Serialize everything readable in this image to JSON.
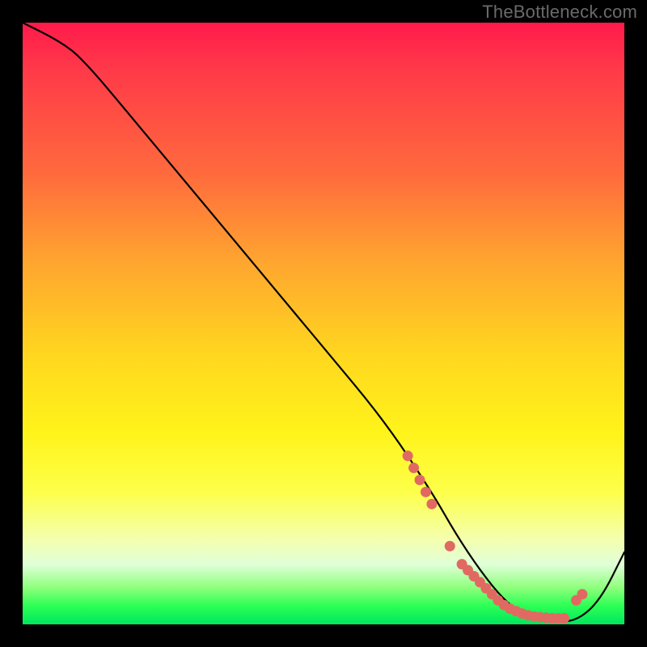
{
  "watermark": "TheBottleneck.com",
  "chart_data": {
    "type": "line",
    "title": "",
    "xlabel": "",
    "ylabel": "",
    "xlim": [
      0,
      100
    ],
    "ylim": [
      0,
      100
    ],
    "series": [
      {
        "name": "curve",
        "x": [
          0,
          6,
          10,
          20,
          30,
          40,
          50,
          60,
          68,
          72,
          76,
          80,
          84,
          88,
          92,
          96,
          100
        ],
        "y": [
          100,
          97,
          94,
          82,
          70,
          58,
          46,
          34,
          22,
          15,
          9,
          4,
          1,
          0.5,
          0.5,
          4,
          12
        ]
      }
    ],
    "markers": {
      "name": "highlight-dots",
      "color": "#e06a62",
      "x": [
        64,
        65,
        66,
        67,
        68,
        71,
        73,
        74,
        75,
        76,
        77,
        78,
        79,
        80,
        81,
        82,
        83,
        84,
        85,
        86,
        87,
        88,
        89,
        90,
        92,
        93
      ],
      "y": [
        28,
        26,
        24,
        22,
        20,
        13,
        10,
        9,
        8,
        7,
        6,
        5,
        4,
        3.2,
        2.6,
        2.2,
        1.8,
        1.5,
        1.3,
        1.2,
        1.1,
        1.0,
        1.0,
        1.0,
        4,
        5
      ]
    }
  }
}
